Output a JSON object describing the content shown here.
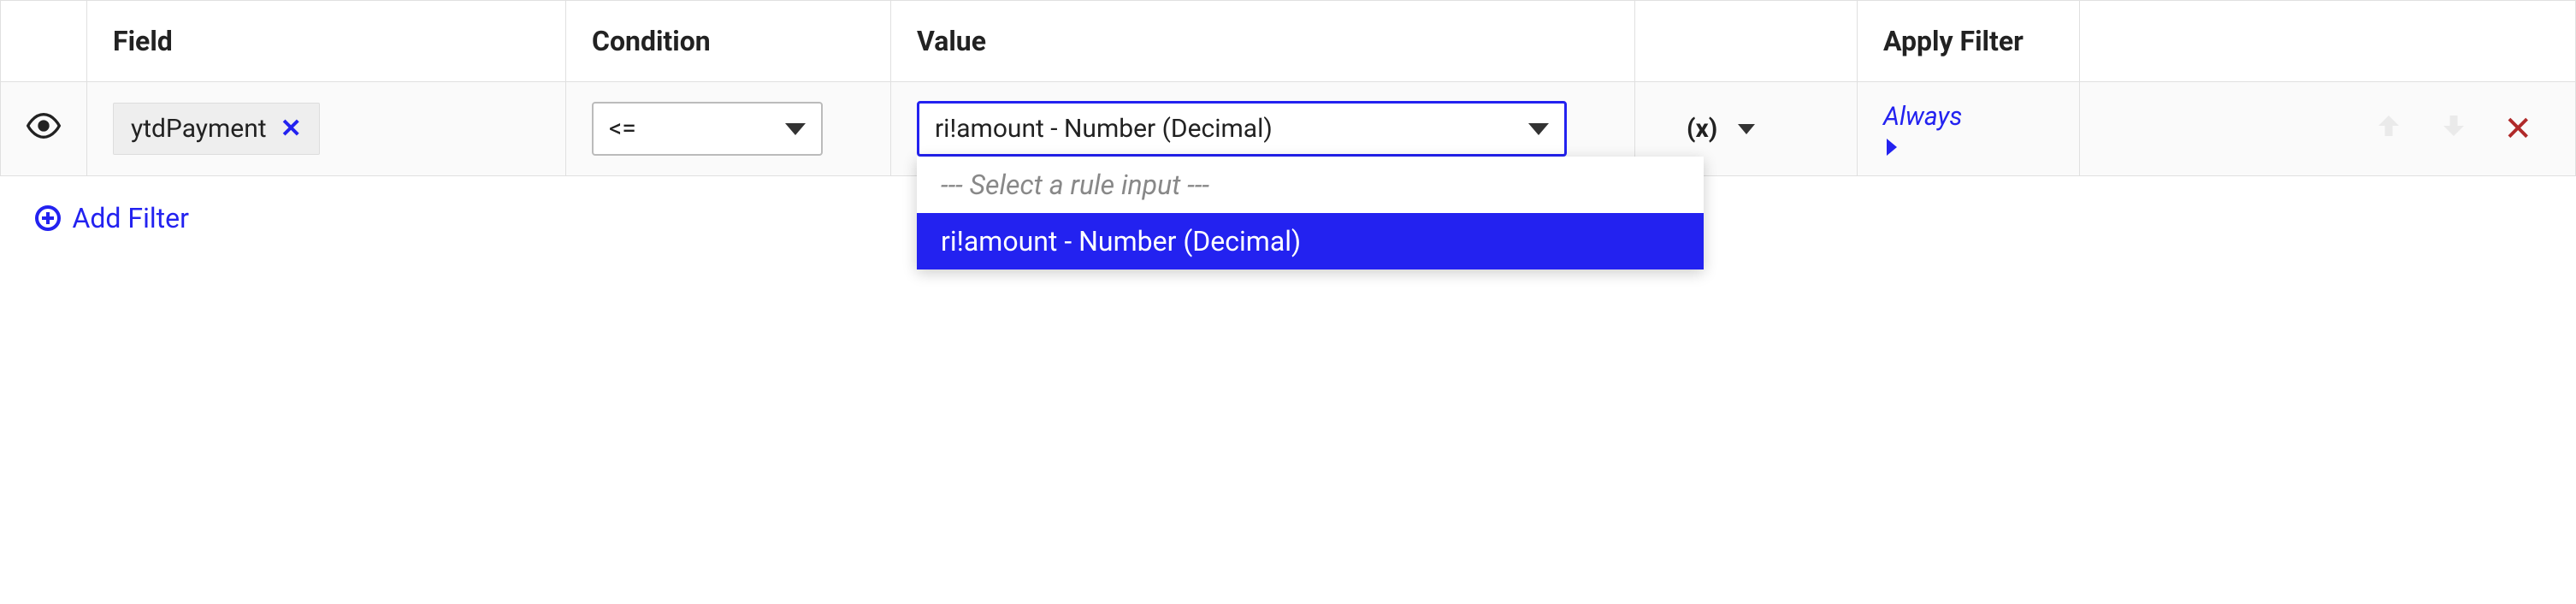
{
  "headers": {
    "field": "Field",
    "condition": "Condition",
    "value": "Value",
    "apply_filter": "Apply Filter"
  },
  "row": {
    "field_chip": "ytdPayment",
    "condition_value": "<=",
    "value_selected": "ri!amount - Number (Decimal)",
    "expr_label": "(x)",
    "apply_label": "Always"
  },
  "dropdown": {
    "placeholder": "--- Select a rule input ---",
    "options": [
      "ri!amount - Number (Decimal)"
    ]
  },
  "footer": {
    "add_filter": "Add Filter"
  }
}
